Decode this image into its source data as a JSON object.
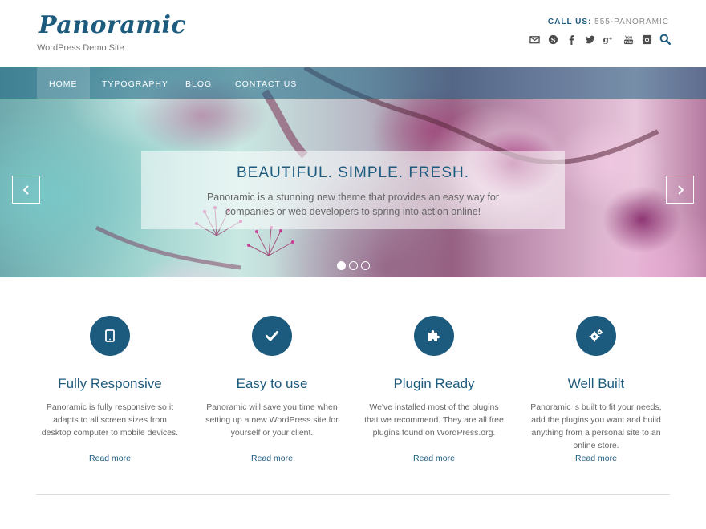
{
  "site": {
    "title": "Panoramic",
    "tagline": "WordPress Demo Site"
  },
  "header": {
    "call_label": "CALL US:",
    "call_number": "555-PANORAMIC",
    "social_icons": [
      "envelope-icon",
      "skype-icon",
      "facebook-icon",
      "twitter-icon",
      "google-plus-icon",
      "youtube-icon",
      "instagram-icon",
      "search-icon"
    ]
  },
  "nav": {
    "items": [
      "HOME",
      "TYPOGRAPHY",
      "BLOG",
      "CONTACT US"
    ],
    "active": "HOME"
  },
  "slider": {
    "heading": "BEAUTIFUL. SIMPLE. FRESH.",
    "text": "Panoramic is a stunning new theme that provides an easy way for companies or web developers to spring into action online!",
    "slide_count": 3,
    "current_slide": 1
  },
  "features": [
    {
      "title": "Fully Responsive",
      "text": "Panoramic is fully responsive so it adapts to all screen sizes from desktop computer to mobile devices.",
      "link": "Read more",
      "icon": "tablet-icon"
    },
    {
      "title": "Easy to use",
      "text": "Panoramic will save you time when setting up a new WordPress site for yourself or your client.",
      "link": "Read more",
      "icon": "checkmark-icon"
    },
    {
      "title": "Plugin Ready",
      "text": "We've installed most of the plugins that we recommend. They are all free plugins found on WordPress.org.",
      "link": "Read more",
      "icon": "puzzle-icon"
    },
    {
      "title": "Well Built",
      "text": "Panoramic is built to fit your needs, add the plugins you want and build anything from a personal site to an online store.",
      "link": "Read more",
      "icon": "gears-icon"
    }
  ],
  "colors": {
    "brand": "#1d5b7e",
    "text": "#666666",
    "nav_overlay": "#1a6080"
  }
}
